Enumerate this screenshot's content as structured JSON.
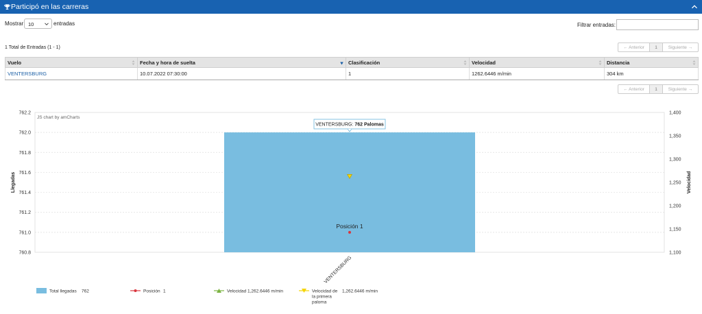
{
  "header": {
    "title": "Participó en las carreras"
  },
  "length": {
    "label": "Mostrar",
    "value": "10",
    "suffix": "entradas"
  },
  "filter": {
    "label": "Filtrar entradas:",
    "value": ""
  },
  "info": "1 Total de Entradas (1 - 1)",
  "pager": {
    "prev": "← Anterior",
    "page": "1",
    "next": "Siguiente →"
  },
  "table": {
    "headers": [
      "Vuelo",
      "Fecha y hora de suelta",
      "Clasificación",
      "Velocidad",
      "Distancia"
    ],
    "rows": [
      {
        "vuelo": "VENTERSBURG",
        "fecha": "10.07.2022 07:30:00",
        "clasificacion": "1",
        "velocidad": "1262.6446 m/min",
        "distancia": "304 km"
      }
    ]
  },
  "chart_data": {
    "type": "bar",
    "credit": "JS chart by amCharts",
    "categories": [
      "VENTERSBURG"
    ],
    "ylabel_left": "Llegadas",
    "ylabel_right": "Velocidad",
    "ylim_left": [
      760.8,
      762.2
    ],
    "yticks_left": [
      "760.8",
      "761.0",
      "761.2",
      "761.4",
      "761.6",
      "761.8",
      "762.0",
      "762.2"
    ],
    "ylim_right": [
      1100,
      1400
    ],
    "yticks_right": [
      "1,100",
      "1,150",
      "1,200",
      "1,250",
      "1,300",
      "1,350",
      "1,400"
    ],
    "grid": true,
    "bar_value": 762,
    "posicion": {
      "value": 761.0,
      "label": "Posición 1"
    },
    "velocidad_primera": 1262.6446,
    "tooltip": {
      "category": "VENTERSBURG:",
      "value": "762 Palomas"
    },
    "legend": [
      {
        "label": "Total llegadas",
        "value": "762",
        "color": "#79bde0",
        "marker": "rect"
      },
      {
        "label": "Posición",
        "value": "1",
        "color": "#d9363e",
        "marker": "line-dot"
      },
      {
        "label": "Velocidad",
        "value": "1,262.6446 m/min",
        "color": "#7cb342",
        "marker": "line-triangle-up"
      },
      {
        "label": "Velocidad de la primera paloma",
        "value": "1,262.6446 m/min",
        "color": "#f5d400",
        "marker": "line-triangle-down"
      }
    ]
  }
}
